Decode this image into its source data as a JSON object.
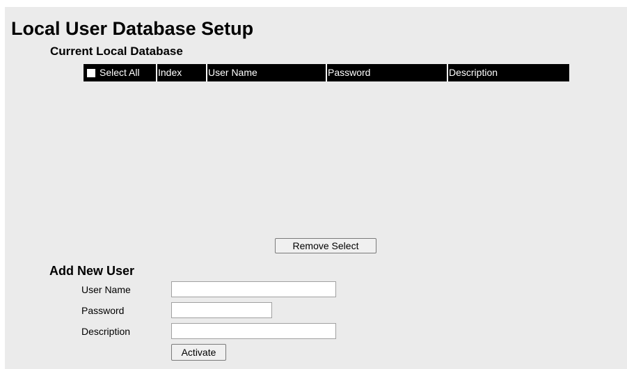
{
  "page": {
    "title": "Local User Database Setup"
  },
  "current_database": {
    "title": "Current Local Database",
    "columns": {
      "select_all": "Select All",
      "index": "Index",
      "user_name": "User Name",
      "password": "Password",
      "description": "Description"
    },
    "select_all_checked": false,
    "rows": [],
    "remove_button": "Remove Select"
  },
  "add_user": {
    "title": "Add New User",
    "user_name_label": "User Name",
    "user_name_value": "",
    "password_label": "Password",
    "password_value": "",
    "description_label": "Description",
    "description_value": "",
    "activate_button": "Activate"
  },
  "colors": {
    "panel_background": "#ebebeb",
    "header_background": "#000000",
    "header_text": "#ffffff"
  }
}
